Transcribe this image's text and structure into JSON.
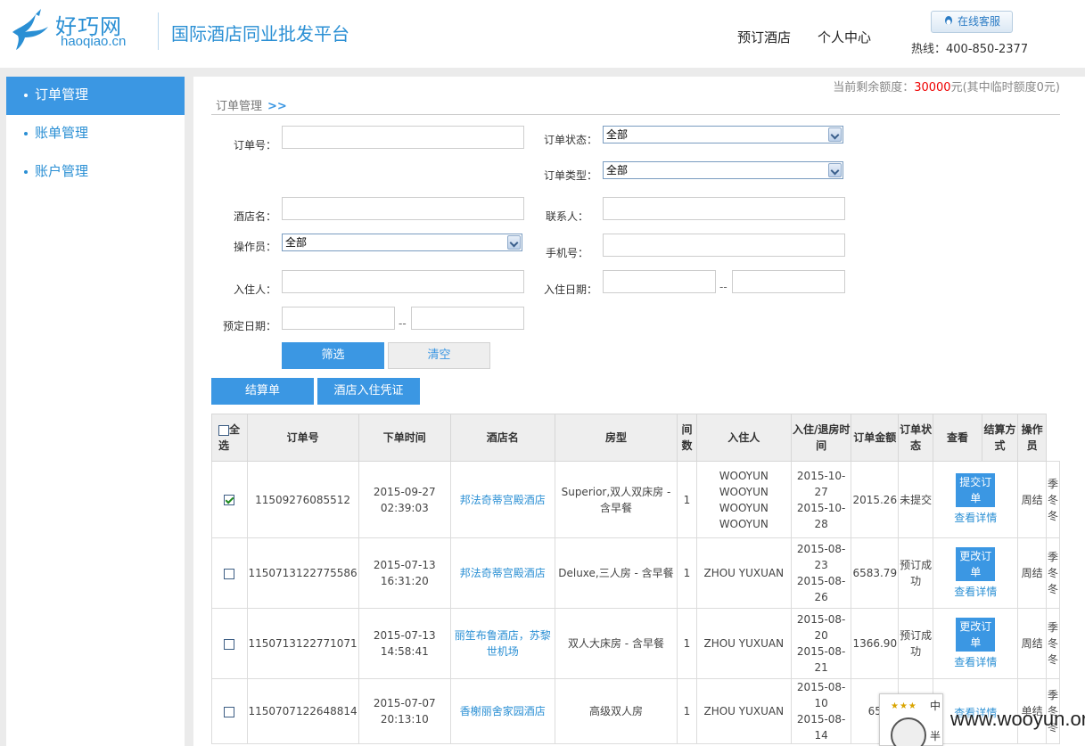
{
  "header": {
    "logo_cn": "好巧网",
    "logo_en": "haoqiao.cn",
    "slogan": "国际酒店同业批发平台",
    "nav": [
      "预订酒店",
      "个人中心"
    ],
    "service_btn": "在线客服",
    "hotline": "热线：400-850-2377"
  },
  "sidebar": {
    "items": [
      {
        "label": "订单管理",
        "active": true
      },
      {
        "label": "账单管理",
        "active": false
      },
      {
        "label": "账户管理",
        "active": false
      }
    ]
  },
  "quota": {
    "prefix": "当前剩余额度：",
    "amount": "30000",
    "suffix": "元(其中临时额度0元)"
  },
  "breadcrumb": {
    "label": "订单管理",
    "arrow": ">>"
  },
  "filters": {
    "order_no": {
      "label": "订单号：",
      "value": ""
    },
    "order_status": {
      "label": "订单状态：",
      "value": "全部"
    },
    "order_type": {
      "label": "订单类型：",
      "value": "全部"
    },
    "hotel_name": {
      "label": "酒店名：",
      "value": ""
    },
    "contact": {
      "label": "联系人：",
      "value": ""
    },
    "operator": {
      "label": "操作员：",
      "value": "全部"
    },
    "phone": {
      "label": "手机号：",
      "value": ""
    },
    "guest": {
      "label": "入住人：",
      "value": ""
    },
    "checkin_date": {
      "label": "入住日期：",
      "from": "",
      "to": "",
      "sep": "--"
    },
    "booking_date": {
      "label": "预定日期：",
      "from": "",
      "to": "",
      "sep": "--"
    }
  },
  "buttons": {
    "filter": "筛选",
    "clear": "清空",
    "settlement": "结算单",
    "voucher": "酒店入住凭证"
  },
  "table": {
    "select_all": "全选",
    "headers": [
      "订单号",
      "下单时间",
      "酒店名",
      "房型",
      "间数",
      "入住人",
      "入住/退房时间",
      "订单金额",
      "订单状态",
      "查看",
      "结算方式",
      "操作员"
    ],
    "rows": [
      {
        "checked": true,
        "order_no": "11509276085512",
        "time_date": "2015-09-27",
        "time_clock": "02:39:03",
        "hotel": "邦法奇蒂宫殿酒店",
        "room": "Superior,双人双床房 - 含早餐",
        "rooms": "1",
        "guests": [
          "WOOYUN",
          "WOOYUN",
          "WOOYUN",
          "WOOYUN"
        ],
        "checkin": "2015-10-27",
        "checkout": "2015-10-28",
        "amount": "2015.26",
        "status": "未提交",
        "action": "提交订单",
        "detail": "查看详情",
        "settle": "周结",
        "operator": "季冬冬"
      },
      {
        "checked": false,
        "order_no": "1150713122775586",
        "time_date": "2015-07-13",
        "time_clock": "16:31:20",
        "hotel": "邦法奇蒂宫殿酒店",
        "room": "Deluxe,三人房 - 含早餐",
        "rooms": "1",
        "guests": [
          "ZHOU YUXUAN"
        ],
        "checkin": "2015-08-23",
        "checkout": "2015-08-26",
        "amount": "6583.79",
        "status": "预订成功",
        "action": "更改订单",
        "detail": "查看详情",
        "settle": "周结",
        "operator": "季冬冬"
      },
      {
        "checked": false,
        "order_no": "1150713122771071",
        "time_date": "2015-07-13",
        "time_clock": "14:58:41",
        "hotel": "丽笙布鲁酒店，苏黎世机场",
        "room": "双人大床房 - 含早餐",
        "rooms": "1",
        "guests": [
          "ZHOU YUXUAN"
        ],
        "checkin": "2015-08-20",
        "checkout": "2015-08-21",
        "amount": "1366.90",
        "status": "预订成功",
        "action": "更改订单",
        "detail": "查看详情",
        "settle": "周结",
        "operator": "季冬冬"
      },
      {
        "checked": false,
        "order_no": "1150707122648814",
        "time_date": "2015-07-07",
        "time_clock": "20:13:10",
        "hotel": "香榭丽舍家园酒店",
        "room": "高级双人房",
        "rooms": "1",
        "guests": [
          "ZHOU YUXUAN"
        ],
        "checkin": "2015-08-10",
        "checkout": "2015-08-14",
        "amount": "65",
        "status": "",
        "action": "",
        "detail": "查看详情",
        "settle": "单结",
        "operator": "季冬冬"
      }
    ]
  },
  "badge": {
    "stars": "★★★",
    "line1": "中",
    "line2": "半"
  },
  "watermark": "www.wooyun.org",
  "colors": {
    "accent": "#3b97e3",
    "link": "#2a8fd4",
    "quota": "#ee0000"
  }
}
